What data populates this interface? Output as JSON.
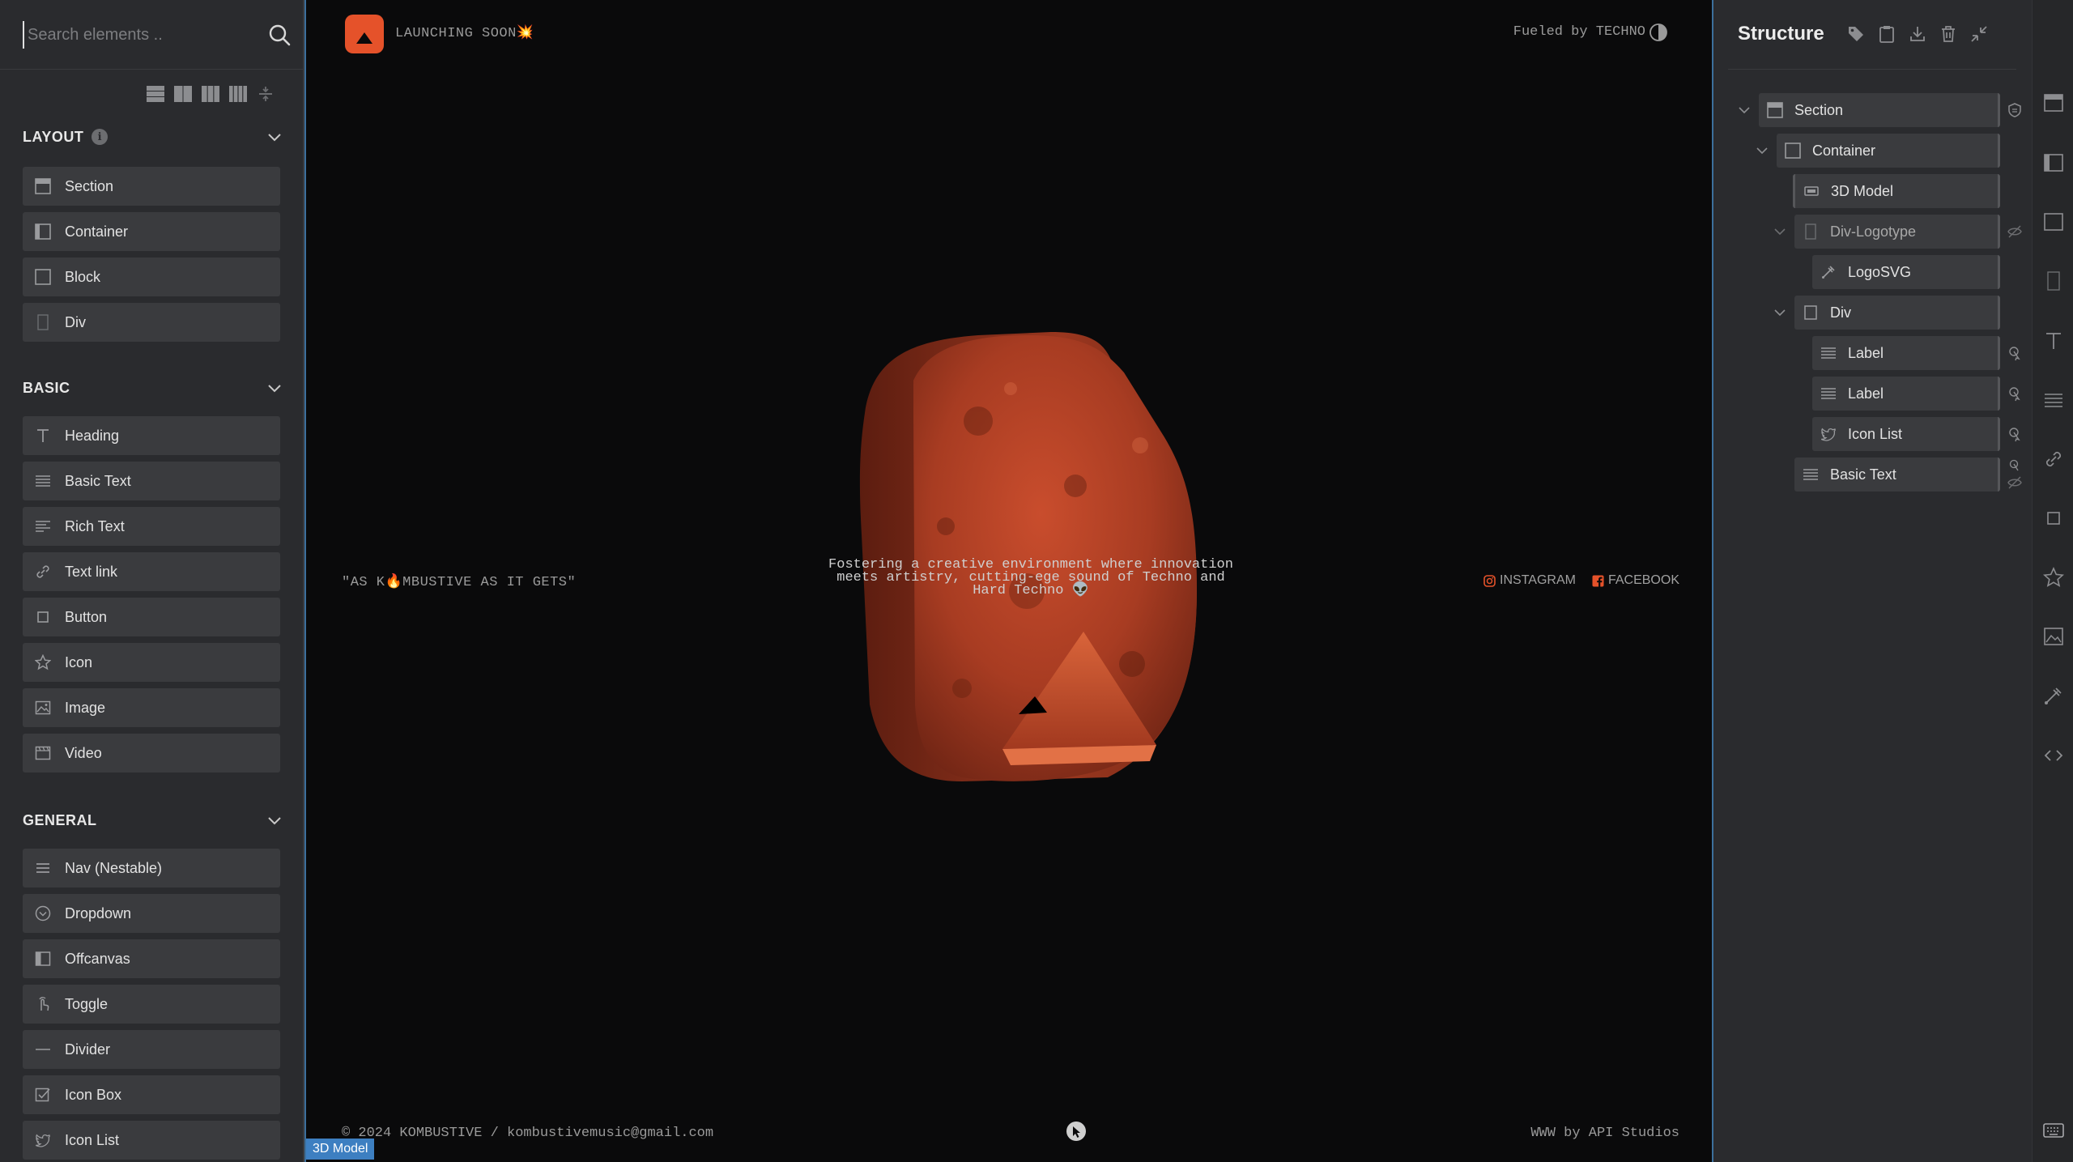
{
  "left_panel": {
    "search": {
      "placeholder": "Search elements ..",
      "value": ""
    },
    "view_toggles": [
      "one-column-icon",
      "two-column-icon",
      "three-column-icon",
      "four-column-icon",
      "collapse-icon"
    ],
    "categories": [
      {
        "title": "LAYOUT",
        "has_info": true,
        "items": [
          {
            "label": "Section",
            "icon": "section-icon"
          },
          {
            "label": "Container",
            "icon": "container-icon"
          },
          {
            "label": "Block",
            "icon": "block-icon"
          },
          {
            "label": "Div",
            "icon": "div-icon"
          }
        ]
      },
      {
        "title": "BASIC",
        "has_info": false,
        "items": [
          {
            "label": "Heading",
            "icon": "heading-icon"
          },
          {
            "label": "Basic Text",
            "icon": "basic-text-icon"
          },
          {
            "label": "Rich Text",
            "icon": "rich-text-icon"
          },
          {
            "label": "Text link",
            "icon": "link-icon"
          },
          {
            "label": "Button",
            "icon": "button-icon"
          },
          {
            "label": "Icon",
            "icon": "star-icon"
          },
          {
            "label": "Image",
            "icon": "image-icon"
          },
          {
            "label": "Video",
            "icon": "video-icon"
          }
        ]
      },
      {
        "title": "GENERAL",
        "has_info": false,
        "items": [
          {
            "label": "Nav (Nestable)",
            "icon": "nav-icon"
          },
          {
            "label": "Dropdown",
            "icon": "dropdown-icon"
          },
          {
            "label": "Offcanvas",
            "icon": "offcanvas-icon"
          },
          {
            "label": "Toggle",
            "icon": "toggle-icon"
          },
          {
            "label": "Divider",
            "icon": "divider-icon"
          },
          {
            "label": "Icon Box",
            "icon": "icon-box-icon"
          },
          {
            "label": "Icon List",
            "icon": "icon-list-icon"
          }
        ]
      }
    ]
  },
  "canvas": {
    "launch_text": "LAUNCHING SOON💥",
    "fueled_text": "Fueled by TECHNO",
    "quote": "\"AS K🔥MBUSTIVE AS IT GETS\"",
    "tagline": "Fostering a creative environment where innovation meets artistry, cutting-ege sound of Techno and Hard Techno 👽",
    "socials": [
      {
        "label": "INSTAGRAM",
        "icon": "instagram-icon"
      },
      {
        "label": "FACEBOOK",
        "icon": "facebook-icon"
      }
    ],
    "copyright": "© 2024 KOMBUSTIVE /  kombustivemusic@gmail.com",
    "credits": "WWW by API Studios",
    "selected_badge": "3D Model",
    "colors": {
      "brand": "#e5522a",
      "model": "#b8442a",
      "selection": "#3d7fc1"
    }
  },
  "structure": {
    "title": "Structure",
    "tools": [
      "tag-icon",
      "clipboard-icon",
      "download-icon",
      "trash-icon",
      "collapse-icon"
    ],
    "nodes": [
      {
        "label": "Section",
        "icon": "section-icon",
        "depth": 0,
        "expanded": true,
        "action": "shield-icon"
      },
      {
        "label": "Container",
        "icon": "container-icon",
        "depth": 1,
        "expanded": true,
        "action": ""
      },
      {
        "label": "3D Model",
        "icon": "model-icon",
        "depth": 2,
        "expanded": null,
        "action": ""
      },
      {
        "label": "Div-Logotype",
        "icon": "div-icon",
        "depth": 2,
        "expanded": true,
        "action": "hidden-icon"
      },
      {
        "label": "LogoSVG",
        "icon": "svg-icon",
        "depth": 3,
        "expanded": null,
        "action": ""
      },
      {
        "label": "Div",
        "icon": "div-icon",
        "depth": 2,
        "expanded": true,
        "action": ""
      },
      {
        "label": "Label",
        "icon": "basic-text-icon",
        "depth": 3,
        "expanded": null,
        "action": "interaction-icon"
      },
      {
        "label": "Label",
        "icon": "basic-text-icon",
        "depth": 3,
        "expanded": null,
        "action": "interaction-icon"
      },
      {
        "label": "Icon List",
        "icon": "icon-list-icon",
        "depth": 3,
        "expanded": null,
        "action": "interaction-icon"
      },
      {
        "label": "Basic Text",
        "icon": "basic-text-icon",
        "depth": 2,
        "expanded": null,
        "action": "interaction-hidden-icon"
      }
    ]
  },
  "right_rail": [
    "section-icon",
    "container-icon",
    "block-icon",
    "div-icon",
    "heading-icon",
    "basic-text-icon",
    "link-icon",
    "button-icon",
    "star-icon",
    "image-icon",
    "svg-icon",
    "code-icon",
    "keyboard-icon"
  ]
}
